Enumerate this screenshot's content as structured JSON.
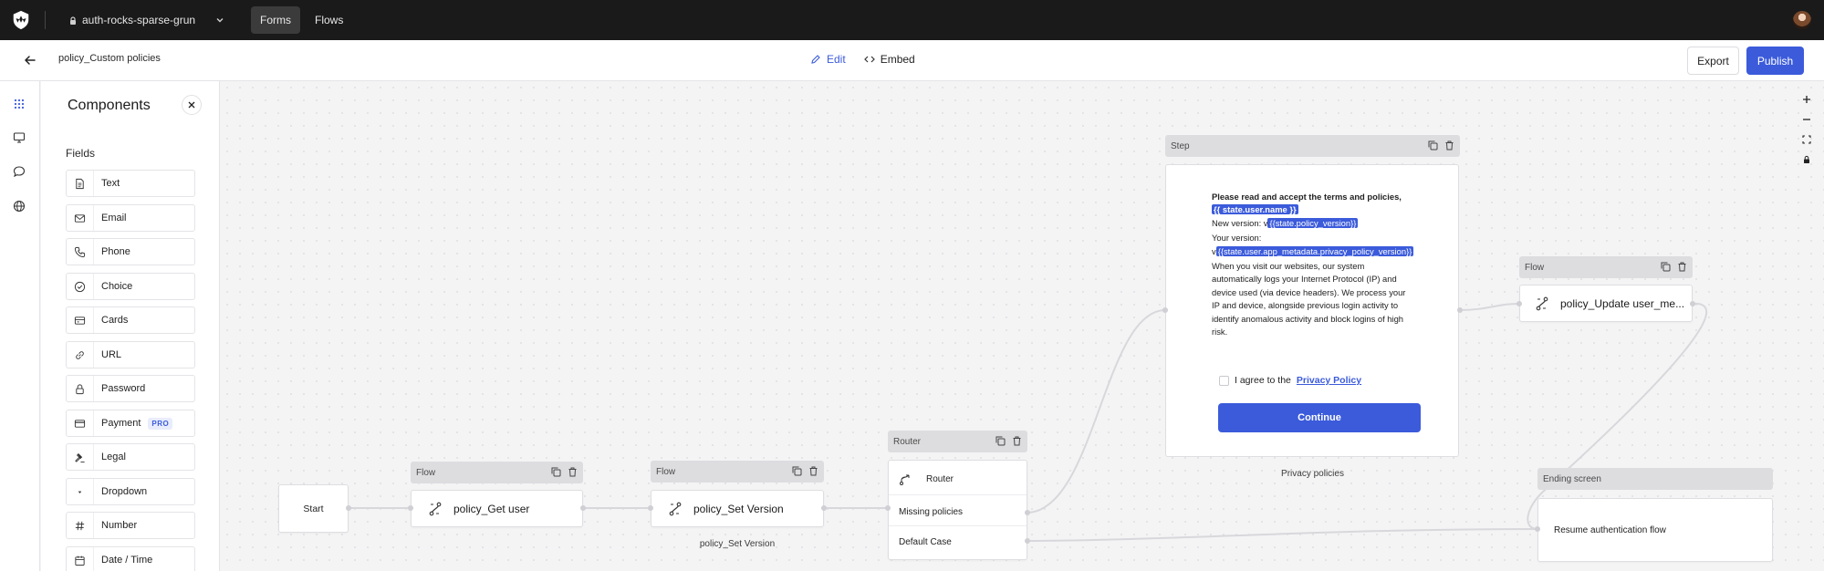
{
  "topbar": {
    "tenant_name": "auth-rocks-sparse-grun",
    "nav": [
      {
        "label": "Forms",
        "active": true
      },
      {
        "label": "Flows",
        "active": false
      }
    ]
  },
  "subheader": {
    "form_name": "policy_Custom policies",
    "tabs": [
      {
        "label": "Edit",
        "active": true
      },
      {
        "label": "Embed",
        "active": false
      }
    ],
    "export_label": "Export",
    "publish_label": "Publish"
  },
  "panel": {
    "title": "Components",
    "section_label": "Fields",
    "fields": [
      {
        "label": "Text",
        "icon": "document-icon"
      },
      {
        "label": "Email",
        "icon": "envelope-icon"
      },
      {
        "label": "Phone",
        "icon": "phone-icon"
      },
      {
        "label": "Choice",
        "icon": "check-circle-icon"
      },
      {
        "label": "Cards",
        "icon": "cards-icon"
      },
      {
        "label": "URL",
        "icon": "link-icon"
      },
      {
        "label": "Password",
        "icon": "lock-icon"
      },
      {
        "label": "Payment",
        "icon": "credit-card-icon",
        "badge": "PRO"
      },
      {
        "label": "Legal",
        "icon": "gavel-icon"
      },
      {
        "label": "Dropdown",
        "icon": "dropdown-icon"
      },
      {
        "label": "Number",
        "icon": "hash-icon"
      },
      {
        "label": "Date / Time",
        "icon": "calendar-icon"
      }
    ]
  },
  "canvas": {
    "start": {
      "label": "Start"
    },
    "flow_get_user": {
      "head": "Flow",
      "label": "policy_Get user"
    },
    "flow_set_version": {
      "head": "Flow",
      "label": "policy_Set Version",
      "caption": "policy_Set Version"
    },
    "router": {
      "head": "Router",
      "title": "Router",
      "routes": [
        "Missing policies",
        "Default Case"
      ]
    },
    "step": {
      "head": "Step",
      "caption": "Privacy policies",
      "intro": "Please read and accept the terms and policies,",
      "token_username": "{{ state.user.name }}",
      "new_version_label": "New version: v",
      "token_policy_version": "{{state.policy_version}}",
      "your_version_label": "Your version:",
      "your_version_prefix": "v",
      "token_user_version": "{{state.user.app_metadata.privacy_policy_version}}",
      "body": "When you visit our websites, our system automatically logs your Internet Protocol (IP) and device used (via device headers). We process your IP and device, alongside previous login activity to identify anomalous activity and block logins of high risk.",
      "agree_text": "I agree to the",
      "agree_link": "Privacy Policy",
      "button": "Continue"
    },
    "flow_update": {
      "head": "Flow",
      "label": "policy_Update user_me..."
    },
    "ending": {
      "head": "Ending screen",
      "label": "Resume authentication flow"
    }
  },
  "colors": {
    "accent": "#3b5bdb",
    "topbar": "#1a1a1a",
    "canvas_bg": "#f4f4f5"
  }
}
